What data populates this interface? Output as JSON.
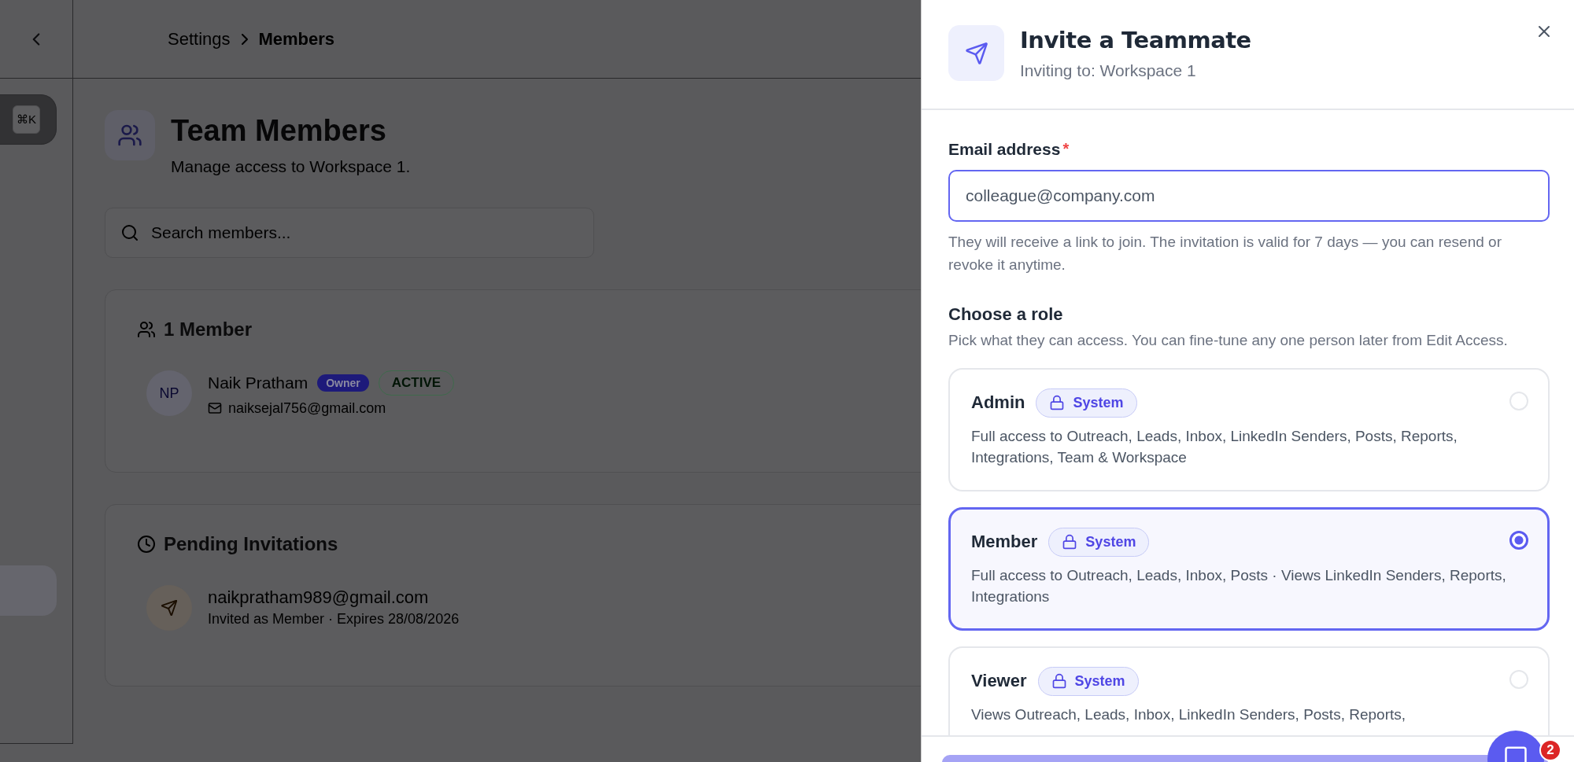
{
  "topbar": {
    "breadcrumb": [
      {
        "label": "Settings",
        "current": false
      },
      {
        "label": "Members",
        "current": true
      }
    ]
  },
  "sidebar": {
    "shortcut": "⌘K"
  },
  "page": {
    "title": "Team Members",
    "subtitle": "Manage access to Workspace 1."
  },
  "search": {
    "placeholder": "Search members..."
  },
  "members": {
    "heading": "1 Member",
    "items": [
      {
        "initials": "NP",
        "name": "Naik Pratham",
        "role_badge": "Owner",
        "status": "ACTIVE",
        "email": "naiksejal756@gmail.com"
      }
    ]
  },
  "invitations": {
    "heading": "Pending Invitations",
    "items": [
      {
        "email": "naikpratham989@gmail.com",
        "details": "Invited as Member · Expires 28/08/2026"
      }
    ]
  },
  "dialog": {
    "title": "Invite a Teammate",
    "subtitle": "Inviting to: Workspace 1",
    "email_label": "Email address",
    "required_mark": "*",
    "email_placeholder": "colleague@company.com",
    "hint": "They will receive a link to join. The invitation is valid for 7 days — you can resend or revoke it anytime.",
    "role_heading": "Choose a role",
    "role_hint": "Pick what they can access. You can fine-tune any one person later from Edit Access.",
    "roles": [
      {
        "name": "Admin",
        "badge": "System",
        "description": "Full access to Outreach, Leads, Inbox, LinkedIn Senders, Posts, Reports, Integrations, Team & Workspace",
        "selected": false
      },
      {
        "name": "Member",
        "badge": "System",
        "description": "Full access to Outreach, Leads, Inbox, Posts · Views LinkedIn Senders, Reports, Integrations",
        "selected": true
      },
      {
        "name": "Viewer",
        "badge": "System",
        "description": "Views Outreach, Leads, Inbox, LinkedIn Senders, Posts, Reports,",
        "selected": false
      }
    ]
  },
  "chat": {
    "badge": "2"
  }
}
